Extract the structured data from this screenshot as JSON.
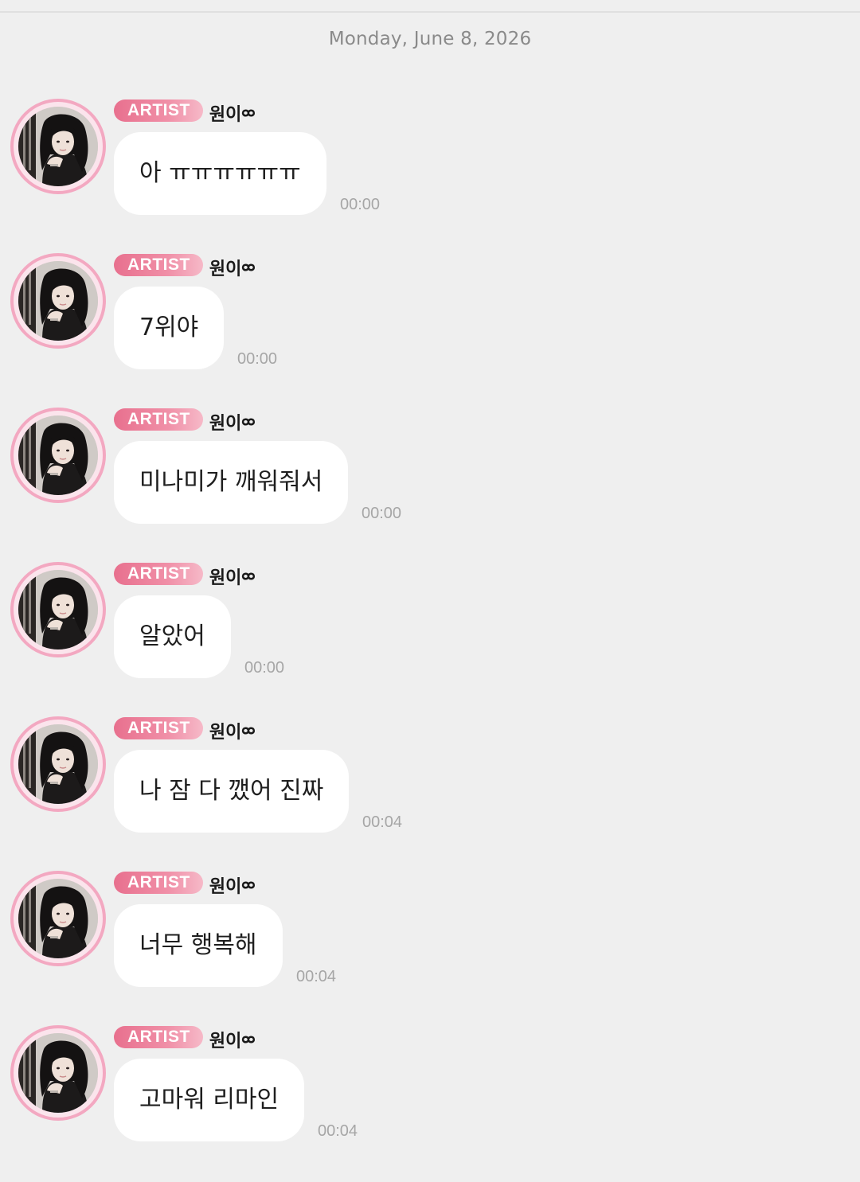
{
  "date_header": "Monday, June 8, 2026",
  "badge_label": "ARTIST",
  "sender_name": "원이ᢁ",
  "colors": {
    "background": "#efefef",
    "bubble": "#ffffff",
    "badge_pink": "#e8708e",
    "avatar_ring": "#f3a8c1",
    "timestamp": "#a6a6a6"
  },
  "messages": [
    {
      "text": "아 ㅠㅠㅠㅠㅠㅠ",
      "time": "00:00"
    },
    {
      "text": "7위야",
      "time": "00:00"
    },
    {
      "text": "미나미가 깨워줘서",
      "time": "00:00"
    },
    {
      "text": "알았어",
      "time": "00:00"
    },
    {
      "text": "나 잠 다 깼어 진짜",
      "time": "00:04"
    },
    {
      "text": "너무 행복해",
      "time": "00:04"
    },
    {
      "text": "고마워 리마인",
      "time": "00:04"
    }
  ]
}
